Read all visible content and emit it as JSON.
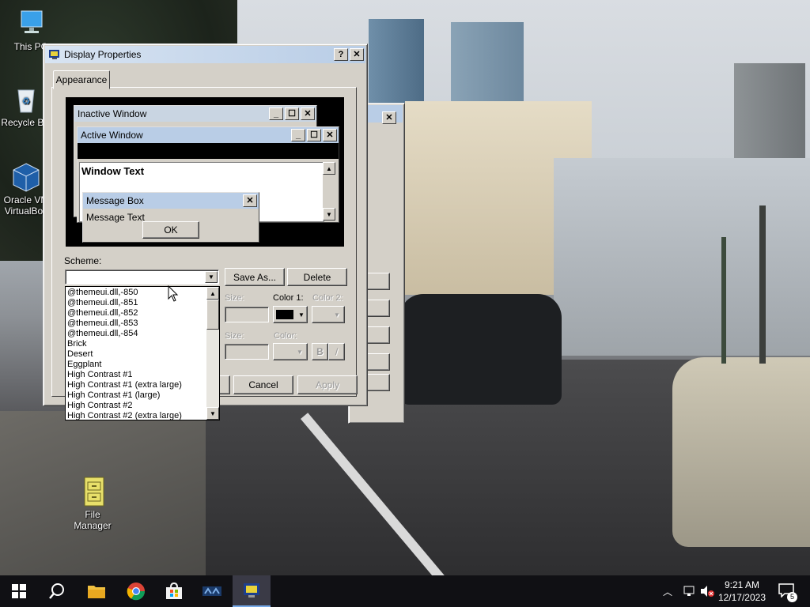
{
  "desktop": {
    "icons": [
      {
        "label": "This PC",
        "icon": "computer-icon"
      },
      {
        "label": "Recycle Bin",
        "icon": "recycle-bin-icon"
      },
      {
        "label": "Oracle VM VirtualBox",
        "icon": "virtualbox-icon"
      },
      {
        "label": "File Manager",
        "icon": "file-cabinet-icon"
      }
    ]
  },
  "dialog": {
    "title": "Display Properties",
    "help_label": "?",
    "close_label": "✕",
    "tab": "Appearance",
    "preview": {
      "inactive_title": "Inactive Window",
      "active_title": "Active Window",
      "window_text": "Window Text",
      "msgbox_title": "Message Box",
      "msgbox_text": "Message Text",
      "ok_label": "OK"
    },
    "scheme_label": "Scheme:",
    "scheme_value": "",
    "save_as_label": "Save As...",
    "delete_label": "Delete",
    "size_label": "Size:",
    "color1_label": "Color 1:",
    "color2_label": "Color 2:",
    "size2_label": "Size:",
    "color_label": "Color:",
    "bold_label": "B",
    "italic_label": "/",
    "ok_partial": "",
    "cancel_label": "Cancel",
    "apply_label": "Apply",
    "scheme_options": [
      "@themeui.dll,-850",
      "@themeui.dll,-851",
      "@themeui.dll,-852",
      "@themeui.dll,-853",
      "@themeui.dll,-854",
      "Brick",
      "Desert",
      "Eggplant",
      "High Contrast #1",
      "High Contrast #1 (extra large)",
      "High Contrast #1 (large)",
      "High Contrast #2",
      "High Contrast #2 (extra large)"
    ]
  },
  "taskbar": {
    "items": [
      "start-icon",
      "search-icon",
      "file-explorer-icon",
      "chrome-icon",
      "store-icon",
      "app-icon",
      "display-properties-icon"
    ],
    "time": "9:21 AM",
    "date": "12/17/2023",
    "notification_count": "5"
  },
  "colors": {
    "titlebar": "#b9cde6",
    "face": "#d4d0c8",
    "taskbar": "#101014"
  }
}
